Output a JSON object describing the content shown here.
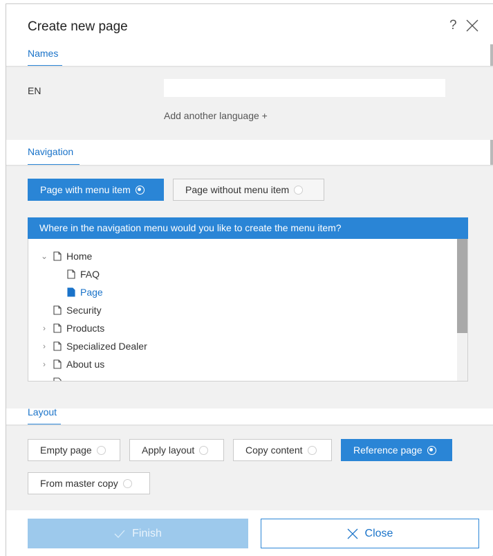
{
  "dialog": {
    "title": "Create new page",
    "help_label": "?"
  },
  "names": {
    "tab_label": "Names",
    "language": "EN",
    "name_value": "",
    "add_language": "Add another language +"
  },
  "navigation": {
    "tab_label": "Navigation",
    "options": [
      {
        "label": "Page with menu item",
        "selected": true
      },
      {
        "label": "Page without menu item",
        "selected": false
      }
    ],
    "tree_prompt": "Where in the navigation menu would you like to create the menu item?",
    "tree": [
      {
        "label": "Home",
        "chevron": "expanded",
        "level": 0,
        "selected": false
      },
      {
        "label": "FAQ",
        "chevron": "none",
        "level": 1,
        "selected": false
      },
      {
        "label": "Page",
        "chevron": "none",
        "level": 1,
        "selected": true
      },
      {
        "label": "Security",
        "chevron": "none",
        "level": 0,
        "selected": false
      },
      {
        "label": "Products",
        "chevron": "collapsed",
        "level": 0,
        "selected": false
      },
      {
        "label": "Specialized Dealer",
        "chevron": "collapsed",
        "level": 0,
        "selected": false
      },
      {
        "label": "About us",
        "chevron": "collapsed",
        "level": 0,
        "selected": false
      }
    ]
  },
  "layout": {
    "tab_label": "Layout",
    "options": [
      {
        "label": "Empty page",
        "selected": false
      },
      {
        "label": "Apply layout",
        "selected": false
      },
      {
        "label": "Copy content",
        "selected": false
      },
      {
        "label": "Reference page",
        "selected": true
      },
      {
        "label": "From master copy",
        "selected": false
      }
    ]
  },
  "footer": {
    "finish_label": "Finish",
    "close_label": "Close"
  },
  "colors": {
    "accent": "#2a85d6",
    "band": "#f1f1f1",
    "finish_disabled": "#9dc9ec"
  }
}
